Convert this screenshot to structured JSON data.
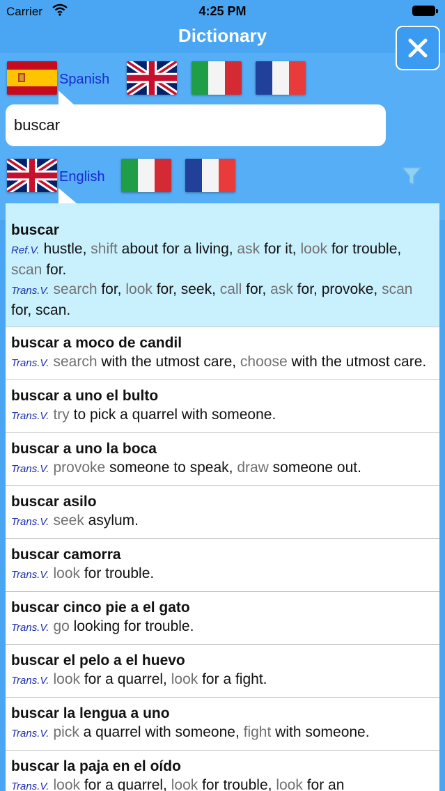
{
  "status_bar": {
    "carrier": "Carrier",
    "time": "4:25 PM"
  },
  "nav": {
    "title": "Dictionary"
  },
  "source": {
    "language": "Spanish"
  },
  "target": {
    "language": "English"
  },
  "search": {
    "value": "buscar",
    "placeholder": ""
  },
  "colors": {
    "background": "#4aa6f3",
    "selected_row": "#c9f1fd",
    "tag_text": "#1c2db0",
    "label_text": "#1a2bd0"
  },
  "entries": [
    {
      "headword": "buscar",
      "selected": true,
      "senses": [
        {
          "tag": "Ref.V.",
          "parts": [
            {
              "t": "hustle, "
            },
            {
              "t": "shift",
              "g": true
            },
            {
              "t": " about for a living, "
            },
            {
              "t": "ask",
              "g": true
            },
            {
              "t": " for it, "
            },
            {
              "t": "look",
              "g": true
            },
            {
              "t": " for trouble, "
            },
            {
              "t": "scan",
              "g": true
            },
            {
              "t": " for."
            }
          ]
        },
        {
          "tag": "Trans.V.",
          "parts": [
            {
              "t": "search",
              "g": true
            },
            {
              "t": " for, "
            },
            {
              "t": "look",
              "g": true
            },
            {
              "t": " for, seek, "
            },
            {
              "t": "call",
              "g": true
            },
            {
              "t": " for, "
            },
            {
              "t": "ask",
              "g": true
            },
            {
              "t": " for, provoke, "
            },
            {
              "t": "scan",
              "g": true
            },
            {
              "t": " for, scan."
            }
          ]
        }
      ]
    },
    {
      "headword": "buscar a moco de candil",
      "senses": [
        {
          "tag": "Trans.V.",
          "parts": [
            {
              "t": "search",
              "g": true
            },
            {
              "t": " with the utmost care, "
            },
            {
              "t": "choose",
              "g": true
            },
            {
              "t": " with the utmost care."
            }
          ]
        }
      ]
    },
    {
      "headword": "buscar a uno el bulto",
      "senses": [
        {
          "tag": "Trans.V.",
          "parts": [
            {
              "t": "try",
              "g": true
            },
            {
              "t": " to pick a quarrel with someone."
            }
          ]
        }
      ]
    },
    {
      "headword": "buscar a uno la boca",
      "senses": [
        {
          "tag": "Trans.V.",
          "parts": [
            {
              "t": "provoke",
              "g": true
            },
            {
              "t": " someone to speak, "
            },
            {
              "t": "draw",
              "g": true
            },
            {
              "t": " someone out."
            }
          ]
        }
      ]
    },
    {
      "headword": "buscar asilo",
      "senses": [
        {
          "tag": "Trans.V.",
          "parts": [
            {
              "t": "seek",
              "g": true
            },
            {
              "t": " asylum."
            }
          ]
        }
      ]
    },
    {
      "headword": "buscar camorra",
      "senses": [
        {
          "tag": "Trans.V.",
          "parts": [
            {
              "t": "look",
              "g": true
            },
            {
              "t": " for trouble."
            }
          ]
        }
      ]
    },
    {
      "headword": "buscar cinco pie a el gato",
      "senses": [
        {
          "tag": "Trans.V.",
          "parts": [
            {
              "t": "go",
              "g": true
            },
            {
              "t": " looking for trouble."
            }
          ]
        }
      ]
    },
    {
      "headword": "buscar el pelo a el huevo",
      "senses": [
        {
          "tag": "Trans.V.",
          "parts": [
            {
              "t": "look",
              "g": true
            },
            {
              "t": " for a quarrel, "
            },
            {
              "t": "look",
              "g": true
            },
            {
              "t": " for a fight."
            }
          ]
        }
      ]
    },
    {
      "headword": "buscar la lengua a uno",
      "senses": [
        {
          "tag": "Trans.V.",
          "parts": [
            {
              "t": "pick",
              "g": true
            },
            {
              "t": " a quarrel with someone, "
            },
            {
              "t": "fight",
              "g": true
            },
            {
              "t": " with someone."
            }
          ]
        }
      ]
    },
    {
      "headword": "buscar la paja en el oído",
      "senses": [
        {
          "tag": "Trans.V.",
          "parts": [
            {
              "t": "look",
              "g": true
            },
            {
              "t": " for a quarrel, "
            },
            {
              "t": "look",
              "g": true
            },
            {
              "t": " for trouble, "
            },
            {
              "t": "look",
              "g": true
            },
            {
              "t": " for an"
            }
          ]
        }
      ]
    }
  ]
}
